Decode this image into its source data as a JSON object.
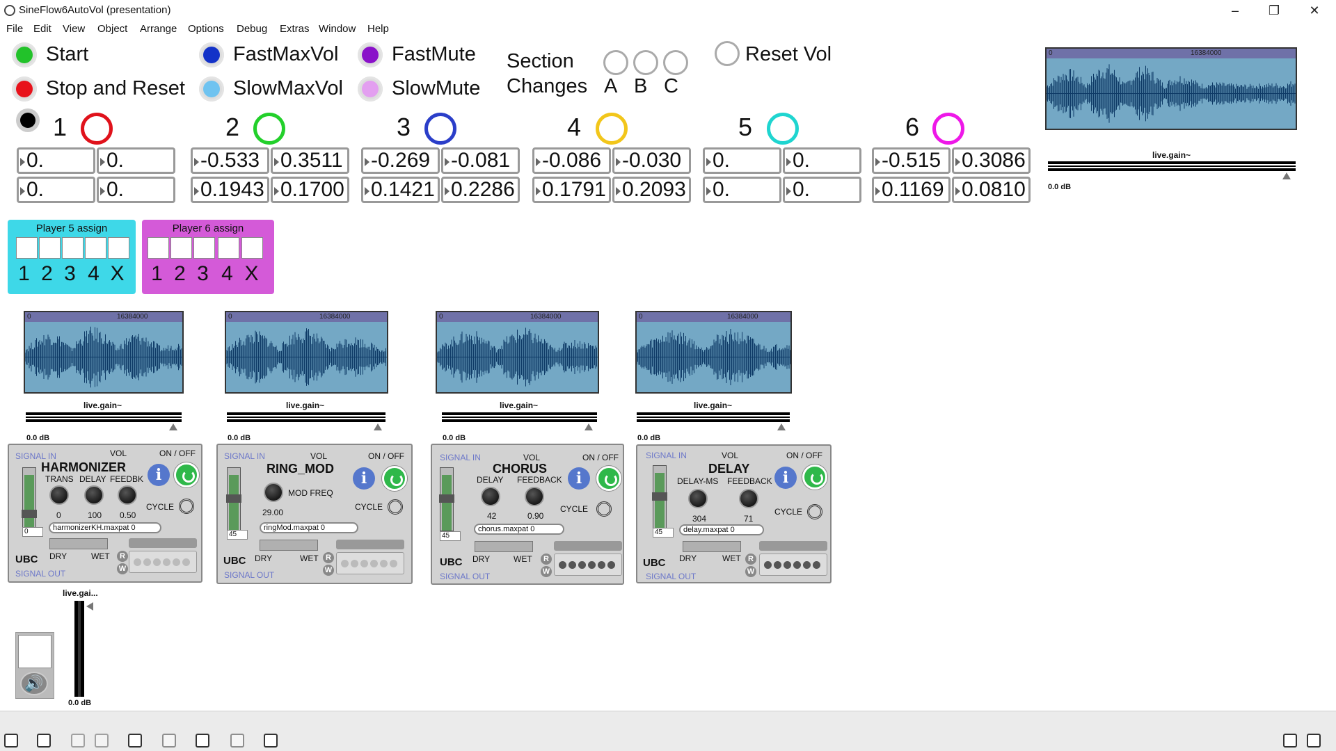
{
  "window": {
    "title": "SineFlow6AutoVol (presentation)",
    "minimize": "–",
    "restore": "❐",
    "close": "✕"
  },
  "menu": [
    "File",
    "Edit",
    "View",
    "Object",
    "Arrange",
    "Options",
    "Debug",
    "Extras",
    "Window",
    "Help"
  ],
  "controls": {
    "start": "Start",
    "stop": "Stop and Reset",
    "fast_max_vol": "FastMaxVol",
    "slow_max_vol": "SlowMaxVol",
    "fast_mute": "FastMute",
    "slow_mute": "SlowMute",
    "section_line1": "Section",
    "section_line2": "Changes",
    "section_a": "A",
    "section_b": "B",
    "section_c": "C",
    "reset_vol": "Reset Vol"
  },
  "colors": {
    "start": "#22c22a",
    "stop": "#e8121b",
    "fast_max": "#1332c8",
    "slow_max": "#6fc3f0",
    "fast_mute": "#8a11c9",
    "slow_mute": "#e39ff0",
    "p1": "#e0121b",
    "p2": "#23d02b",
    "p3": "#2b3ec9",
    "p4": "#f2c61b",
    "p5": "#1fd5d0",
    "p6": "#ee18e8"
  },
  "players": [
    {
      "num": "1",
      "vals": [
        "0.",
        "0.",
        "0.",
        "0."
      ]
    },
    {
      "num": "2",
      "vals": [
        "-0.533",
        "0.3511",
        "0.1943",
        "0.1700"
      ]
    },
    {
      "num": "3",
      "vals": [
        "-0.269",
        "-0.081",
        "0.1421",
        "0.2286"
      ]
    },
    {
      "num": "4",
      "vals": [
        "-0.086",
        "-0.030",
        "0.1791",
        "0.2093"
      ]
    },
    {
      "num": "5",
      "vals": [
        "0.",
        "0.",
        "0.",
        "0."
      ]
    },
    {
      "num": "6",
      "vals": [
        "-0.515",
        "0.3086",
        "0.1169",
        "0.0810"
      ]
    }
  ],
  "assign": [
    {
      "title": "Player 5 assign",
      "digits": [
        "1",
        "2",
        "3",
        "4",
        "X"
      ],
      "color": "#3ed8e8"
    },
    {
      "title": "Player 6 assign",
      "digits": [
        "1",
        "2",
        "3",
        "4",
        "X"
      ],
      "color": "#d45ad8"
    }
  ],
  "main_wave": {
    "start": "0",
    "end": "16384000",
    "gain_label": "live.gain~",
    "gain_db": "0.0 dB"
  },
  "fx_waves": [
    {
      "start": "0",
      "end": "16384000",
      "gain_label": "live.gain~",
      "gain_db": "0.0 dB"
    },
    {
      "start": "0",
      "end": "16384000",
      "gain_label": "live.gain~",
      "gain_db": "0.0 dB"
    },
    {
      "start": "0",
      "end": "16384000",
      "gain_label": "live.gain~",
      "gain_db": "0.0 dB"
    },
    {
      "start": "0",
      "end": "16384000",
      "gain_label": "live.gain~",
      "gain_db": "0.0 dB"
    }
  ],
  "fx_common": {
    "signal_in": "SIGNAL IN",
    "signal_out": "SIGNAL OUT",
    "vol": "VOL",
    "on_off": "ON / OFF",
    "cycle": "CYCLE",
    "dry": "DRY",
    "wet": "WET",
    "ubc": "UBC",
    "r": "R",
    "w": "W",
    "info": "i"
  },
  "fx": [
    {
      "name": "HARMONIZER",
      "knobs": [
        {
          "label": "TRANS",
          "value": "0"
        },
        {
          "label": "DELAY",
          "value": "100"
        },
        {
          "label": "FEEDBK",
          "value": "0.50"
        }
      ],
      "msg": "harmonizerKH.maxpat 0",
      "numbox": "0"
    },
    {
      "name": "RING_MOD",
      "knobs": [
        {
          "label": "MOD FREQ",
          "value": "29.00"
        }
      ],
      "msg": "ringMod.maxpat 0",
      "numbox": "45"
    },
    {
      "name": "CHORUS",
      "knobs": [
        {
          "label": "DELAY",
          "value": "42"
        },
        {
          "label": "FEEDBACK",
          "value": "0.90"
        }
      ],
      "msg": "chorus.maxpat 0",
      "numbox": "45"
    },
    {
      "name": "DELAY",
      "knobs": [
        {
          "label": "DELAY-MS",
          "value": "304"
        },
        {
          "label": "FEEDBACK",
          "value": "71"
        }
      ],
      "msg": "delay.maxpat 0",
      "numbox": "45"
    }
  ],
  "output": {
    "gain_label": "live.gai...",
    "gain_db": "0.0 dB",
    "speaker_icon": "speaker-icon"
  }
}
